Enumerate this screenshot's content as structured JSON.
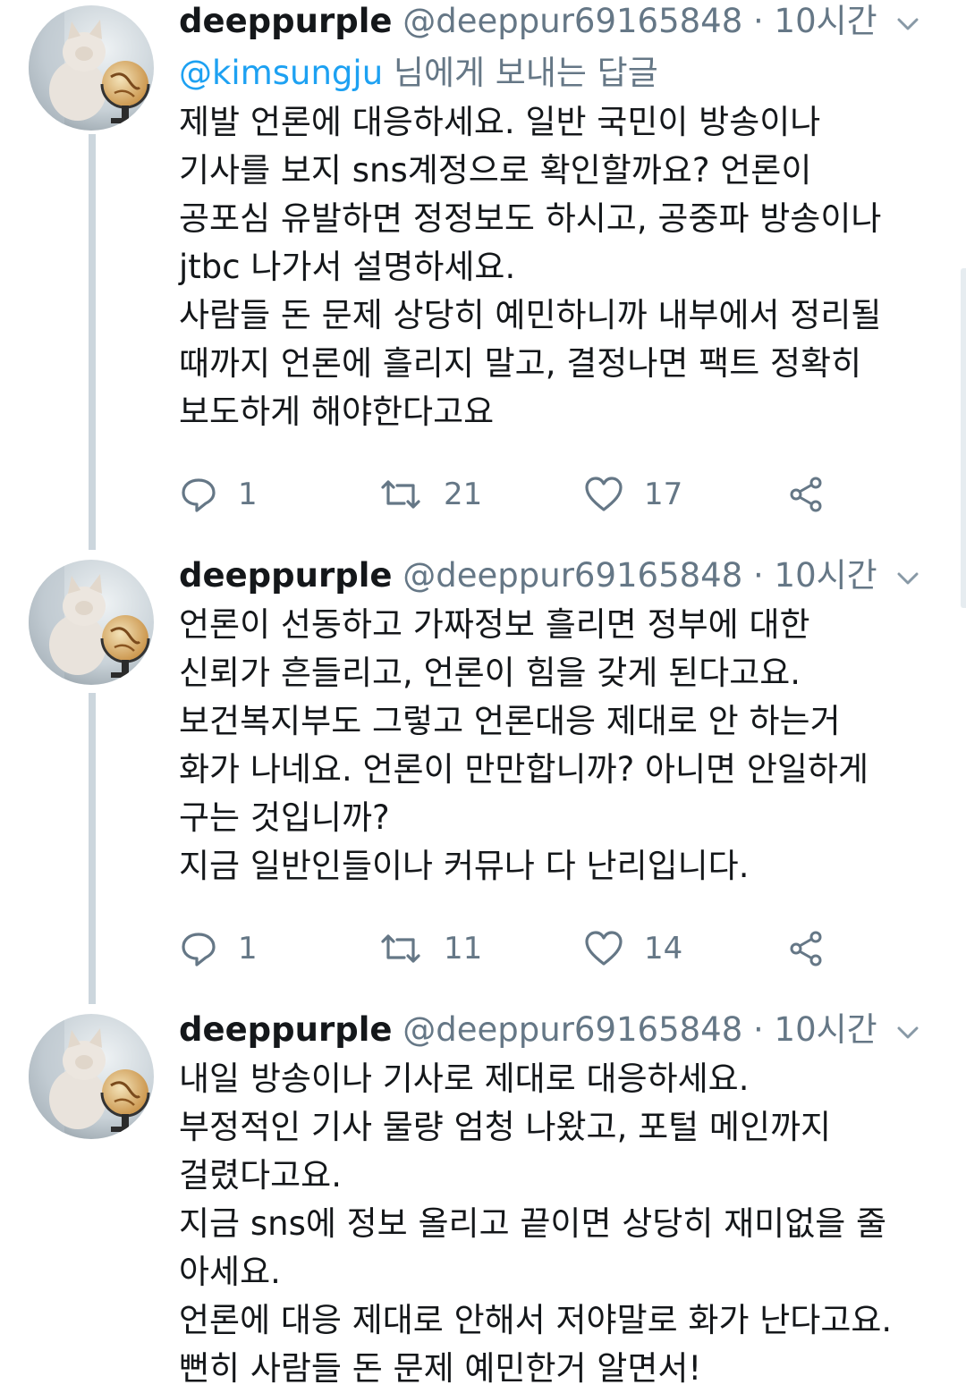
{
  "tweets": [
    {
      "name": "deeppurple",
      "handle": "@deeppur69165848",
      "dot": "·",
      "time": "10시간",
      "reply_mention": "@kimsungju",
      "reply_suffix": " 님에게 보내는 답글",
      "lines": [
        "제발 언론에 대응하세요. 일반 국민이 방송이나",
        "기사를 보지 sns계정으로 확인할까요? 언론이",
        "공포심 유발하면 정정보도 하시고, 공중파 방송이나",
        "jtbc 나가서 설명하세요.",
        "사람들 돈 문제 상당히 예민하니까 내부에서 정리될",
        "때까지 언론에 흘리지 말고, 결정나면 팩트 정확히",
        "보도하게 해야한다고요"
      ],
      "replies": "1",
      "retweets": "21",
      "likes": "17"
    },
    {
      "name": "deeppurple",
      "handle": "@deeppur69165848",
      "dot": "·",
      "time": "10시간",
      "lines": [
        "언론이 선동하고 가짜정보 흘리면 정부에 대한",
        "신뢰가 흔들리고, 언론이 힘을 갖게 된다고요.",
        "보건복지부도 그렇고 언론대응 제대로 안 하는거",
        "화가 나네요. 언론이 만만합니까? 아니면 안일하게",
        "구는 것입니까?",
        "지금 일반인들이나 커뮤나 다 난리입니다."
      ],
      "replies": "1",
      "retweets": "11",
      "likes": "14"
    },
    {
      "name": "deeppurple",
      "handle": "@deeppur69165848",
      "dot": "·",
      "time": "10시간",
      "lines": [
        "내일 방송이나 기사로 제대로 대응하세요.",
        "부정적인 기사 물량 엄청 나왔고, 포털 메인까지",
        "걸렸다고요.",
        "지금 sns에 정보 올리고 끝이면 상당히 재미없을 줄",
        "아세요.",
        "언론에 대응 제대로 안해서 저야말로 화가 난다고요.",
        "뻔히 사람들 돈 문제 예민한거 알면서!"
      ]
    }
  ],
  "icons": {
    "reply": "reply-icon",
    "retweet": "retweet-icon",
    "like": "heart-icon",
    "share": "share-icon",
    "caret": "chevron-down-icon",
    "avatar": "kitten-with-globe-avatar"
  },
  "colors": {
    "text": "#14171a",
    "secondary": "#657786",
    "link": "#1da1f2",
    "thread_line": "#ccd6dd"
  }
}
